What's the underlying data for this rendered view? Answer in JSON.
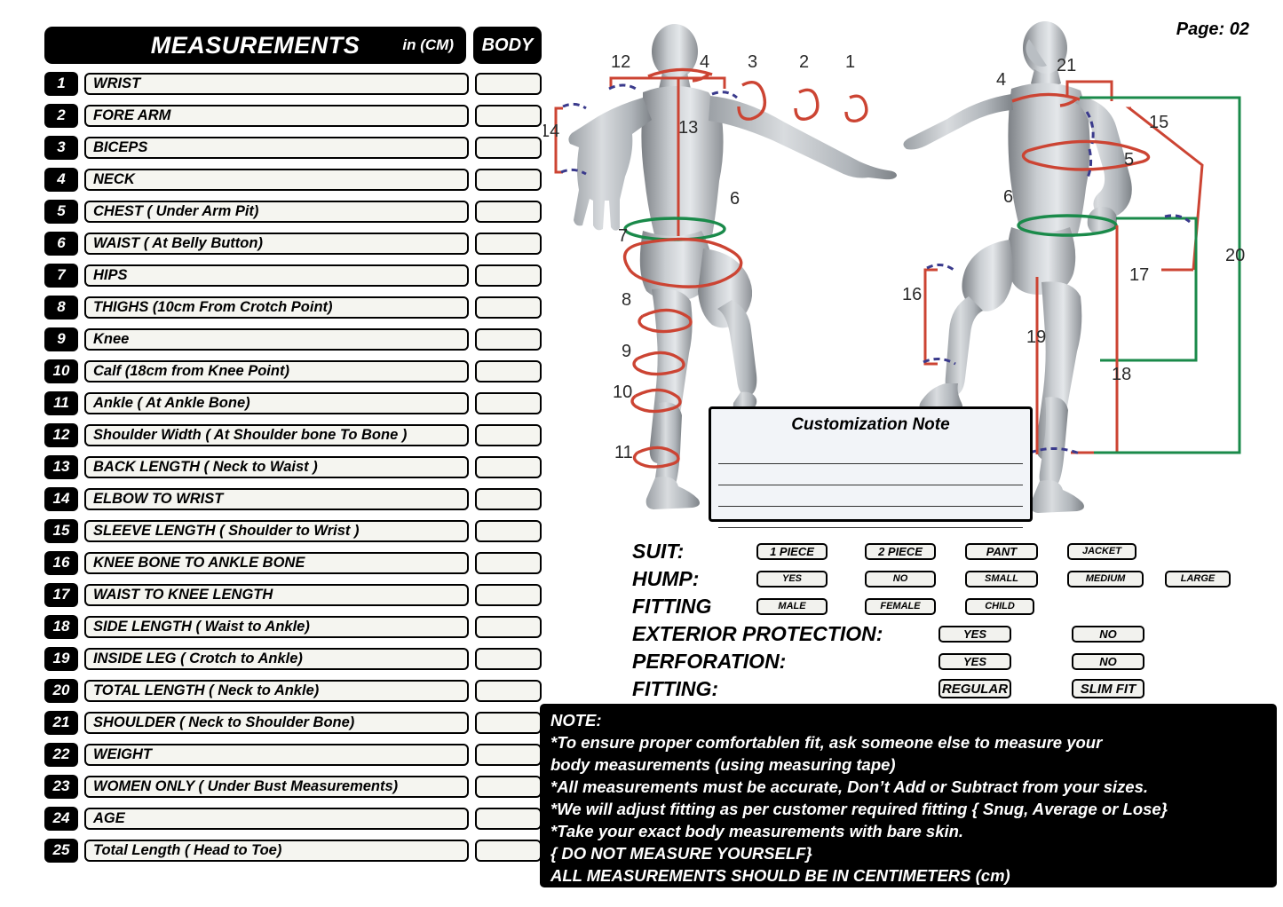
{
  "page": {
    "page_label": "Page: 02"
  },
  "list": {
    "header": {
      "title": "MEASUREMENTS",
      "unit": "in (CM)",
      "body_column": "BODY"
    },
    "rows": [
      {
        "num": "1",
        "label": "WRIST",
        "value": ""
      },
      {
        "num": "2",
        "label": "FORE ARM",
        "value": ""
      },
      {
        "num": "3",
        "label": "BICEPS",
        "value": ""
      },
      {
        "num": "4",
        "label": "NECK",
        "value": ""
      },
      {
        "num": "5",
        "label": "CHEST ( Under Arm Pit)",
        "value": ""
      },
      {
        "num": "6",
        "label": "WAIST ( At Belly Button)",
        "value": ""
      },
      {
        "num": "7",
        "label": "HIPS",
        "value": ""
      },
      {
        "num": "8",
        "label": "THIGHS (10cm  From  Crotch Point)",
        "value": ""
      },
      {
        "num": "9",
        "label": "Knee",
        "value": ""
      },
      {
        "num": "10",
        "label": "Calf (18cm from Knee Point)",
        "value": ""
      },
      {
        "num": "11",
        "label": "Ankle ( At Ankle Bone)",
        "value": ""
      },
      {
        "num": "12",
        "label": "Shoulder Width ( At Shoulder bone To Bone )",
        "value": ""
      },
      {
        "num": "13",
        "label": "BACK LENGTH ( Neck to Waist )",
        "value": ""
      },
      {
        "num": "14",
        "label": "ELBOW TO WRIST",
        "value": ""
      },
      {
        "num": "15",
        "label": "SLEEVE LENGTH ( Shoulder to Wrist )",
        "value": ""
      },
      {
        "num": "16",
        "label": "KNEE BONE TO ANKLE BONE",
        "value": ""
      },
      {
        "num": "17",
        "label": "WAIST TO KNEE LENGTH",
        "value": ""
      },
      {
        "num": "18",
        "label": "SIDE LENGTH ( Waist to Ankle)",
        "value": ""
      },
      {
        "num": "19",
        "label": "INSIDE LEG ( Crotch to Ankle)",
        "value": ""
      },
      {
        "num": "20",
        "label": "TOTAL LENGTH ( Neck to Ankle)",
        "value": ""
      },
      {
        "num": "21",
        "label": "SHOULDER ( Neck to Shoulder Bone)",
        "value": ""
      },
      {
        "num": "22",
        "label": "WEIGHT",
        "value": ""
      },
      {
        "num": "23",
        "label": "WOMEN ONLY ( Under Bust Measurements)",
        "value": ""
      },
      {
        "num": "24",
        "label": "AGE",
        "value": ""
      },
      {
        "num": "25",
        "label": "Total Length ( Head to Toe)",
        "value": ""
      }
    ]
  },
  "figures": {
    "back_view": {
      "callouts": [
        "12",
        "4",
        "3",
        "2",
        "1",
        "14",
        "13",
        "6",
        "7",
        "8",
        "9",
        "10",
        "11"
      ]
    },
    "front_view": {
      "callouts": [
        "4",
        "21",
        "15",
        "5",
        "6",
        "16",
        "17",
        "19",
        "18",
        "20"
      ]
    }
  },
  "customization_note": {
    "title": "Customization Note",
    "lines": [
      "",
      "",
      "",
      ""
    ]
  },
  "options": {
    "rows": [
      {
        "label": "SUIT:",
        "choices": [
          "1 PIECE",
          "2 PIECE",
          "PANT",
          "JACKET"
        ]
      },
      {
        "label": "HUMP:",
        "choices": [
          "YES",
          "NO",
          "SMALL",
          "MEDIUM",
          "LARGE"
        ]
      },
      {
        "label": "FITTING",
        "choices": [
          "MALE",
          "FEMALE",
          "CHILD"
        ]
      },
      {
        "label": "EXTERIOR PROTECTION:",
        "choices": [
          "YES",
          "NO"
        ]
      },
      {
        "label": "PERFORATION:",
        "choices": [
          "YES",
          "NO"
        ]
      },
      {
        "label": "FITTING:",
        "choices": [
          "REGULAR",
          "SLIM FIT"
        ]
      }
    ]
  },
  "note": {
    "lines": [
      "NOTE:",
      "*To ensure proper comfortablen  fit, ask someone else to measure your",
      "body measurements (using measuring tape)",
      "*All measurements must be accurate, Don’t Add or Subtract from your sizes.",
      "*We will adjust fitting as per customer required fitting { Snug, Average or Lose}",
      "*Take your exact body measurements with bare skin.",
      "{ DO NOT MEASURE YOURSELF}",
      "ALL MEASUREMENTS SHOULD BE IN CENTIMETERS (cm)"
    ]
  },
  "colors": {
    "black": "#000000",
    "field_fill": "#f5f5f0",
    "measure_red": "#cc4433",
    "measure_green": "#1a8a4a",
    "measure_blue": "#3a3a8c",
    "body_grey": "#a8acb0"
  }
}
